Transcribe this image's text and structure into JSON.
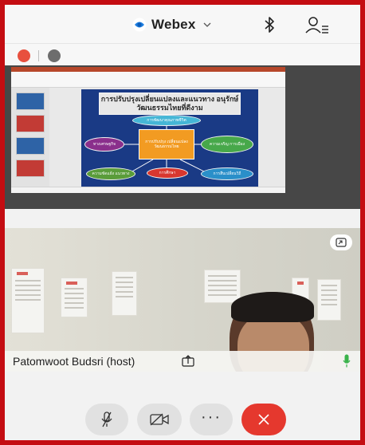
{
  "header": {
    "app_name": "Webex"
  },
  "slide": {
    "title": "การปรับปรุงเปลี่ยนแปลงและแนวทาง อนุรักษ์วัฒนธรรมไทยที่ดีงาม",
    "nodes": [
      "การพัฒนาคุณภาพชีวิต",
      "การปรับปรุง เปลี่ยนแปลงวัฒนธรรมไทย",
      "ทางเศรษฐกิจ",
      "ความเจริญ การเมือง",
      "การศึกษา",
      "ความขัดแย้ง แนวทาง",
      "การสืบเปลี่ยนวิถี"
    ]
  },
  "participant": {
    "name": "Patomwoot Budsri (host)"
  },
  "colors": {
    "frame": "#c40d12",
    "end_button": "#e5382e",
    "mic_active": "#39b24a",
    "brand_blue": "#1f7fe0"
  },
  "icons": {
    "brand": "webex-logo-icon",
    "dropdown": "chevron-down-icon",
    "bluetooth": "bluetooth-icon",
    "participants": "participants-icon",
    "pip": "pip-icon",
    "share": "share-icon",
    "mic": "mic-icon",
    "mute": "mute-icon",
    "camera": "camera-off-icon",
    "more": "more-icon",
    "end": "end-call-icon"
  }
}
